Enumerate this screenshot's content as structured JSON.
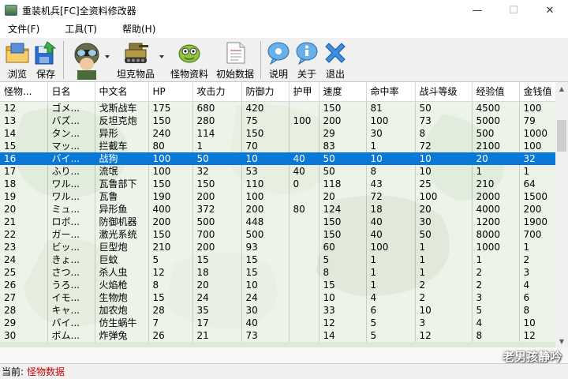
{
  "window": {
    "title": "重装机兵[FC]全资料修改器",
    "minimize": "—",
    "maximize": "☐",
    "close": "✕"
  },
  "menu": [
    "文件(F)",
    "工具(T)",
    "帮助(H)"
  ],
  "toolbar": {
    "browse": "浏览",
    "save": "保存",
    "tank_items": "坦克物品",
    "monster_data": "怪物资料",
    "init_data": "初始数据",
    "help": "说明",
    "about": "关于",
    "exit": "退出"
  },
  "table": {
    "columns": [
      "怪物...",
      "日名",
      "中文名",
      "HP",
      "攻击力",
      "防御力",
      "护甲",
      "速度",
      "命中率",
      "战斗等级",
      "经验值",
      "金钱值"
    ],
    "selected_row_index": 4,
    "rows": [
      [
        "12",
        "ゴメ...",
        "戈斯战车",
        "175",
        "680",
        "420",
        "",
        "150",
        "81",
        "50",
        "4500",
        "100"
      ],
      [
        "13",
        "バズ...",
        "反坦克炮",
        "150",
        "280",
        "75",
        "100",
        "200",
        "100",
        "73",
        "5000",
        "79"
      ],
      [
        "14",
        "タン...",
        "异形",
        "240",
        "114",
        "150",
        "",
        "29",
        "30",
        "8",
        "500",
        "1000"
      ],
      [
        "15",
        "マッ...",
        "拦截车",
        "80",
        "1",
        "70",
        "",
        "83",
        "1",
        "72",
        "2100",
        "100"
      ],
      [
        "16",
        "バイ...",
        "战狗",
        "100",
        "50",
        "10",
        "40",
        "50",
        "10",
        "10",
        "20",
        "32"
      ],
      [
        "17",
        "ふり...",
        "流氓",
        "100",
        "32",
        "53",
        "40",
        "50",
        "8",
        "10",
        "1",
        "1"
      ],
      [
        "18",
        "ワル...",
        "瓦鲁部下",
        "150",
        "150",
        "110",
        "0",
        "118",
        "43",
        "25",
        "210",
        "64"
      ],
      [
        "19",
        "ワル...",
        "瓦鲁",
        "190",
        "200",
        "100",
        "",
        "20",
        "72",
        "100",
        "2000",
        "1500"
      ],
      [
        "20",
        "ミュ...",
        "异形鱼",
        "400",
        "372",
        "200",
        "80",
        "124",
        "18",
        "20",
        "4000",
        "200"
      ],
      [
        "21",
        "ロボ...",
        "防御机器",
        "200",
        "500",
        "448",
        "",
        "150",
        "40",
        "30",
        "1200",
        "1900"
      ],
      [
        "22",
        "ガー...",
        "激光系统",
        "150",
        "700",
        "500",
        "",
        "150",
        "40",
        "50",
        "8000",
        "700"
      ],
      [
        "23",
        "ビッ...",
        "巨型炮",
        "210",
        "200",
        "93",
        "",
        "60",
        "100",
        "1",
        "1000",
        "1"
      ],
      [
        "24",
        "きょ...",
        "巨蚊",
        "5",
        "15",
        "15",
        "",
        "5",
        "1",
        "1",
        "1",
        "2"
      ],
      [
        "25",
        "さつ...",
        "杀人虫",
        "12",
        "18",
        "15",
        "",
        "8",
        "1",
        "1",
        "2",
        "3"
      ],
      [
        "26",
        "うろ...",
        "火焰枪",
        "8",
        "20",
        "10",
        "",
        "15",
        "1",
        "2",
        "2",
        "4"
      ],
      [
        "27",
        "イモ...",
        "生物炮",
        "15",
        "24",
        "24",
        "",
        "10",
        "4",
        "2",
        "3",
        "6"
      ],
      [
        "28",
        "キャ...",
        "加农炮",
        "28",
        "35",
        "30",
        "",
        "33",
        "6",
        "10",
        "5",
        "8"
      ],
      [
        "29",
        "バイ...",
        "仿生蜗牛",
        "7",
        "17",
        "40",
        "",
        "12",
        "5",
        "3",
        "4",
        "10"
      ],
      [
        "30",
        "ボム...",
        "炸弹兔",
        "26",
        "21",
        "73",
        "",
        "14",
        "5",
        "12",
        "8",
        "12"
      ]
    ]
  },
  "status": {
    "label": "当前:",
    "value": "怪物数据"
  },
  "watermark": "老男孩静吟",
  "colors": {
    "selection": "#0a78d7",
    "status_value": "#d00000",
    "toolbar_bg": "#f0f0f0"
  },
  "icons": [
    "folder-icon",
    "save-icon",
    "pilot-avatar-icon",
    "tank-icon",
    "monster-icon",
    "document-icon",
    "help-bubble-icon",
    "about-bubble-icon",
    "exit-x-icon"
  ]
}
